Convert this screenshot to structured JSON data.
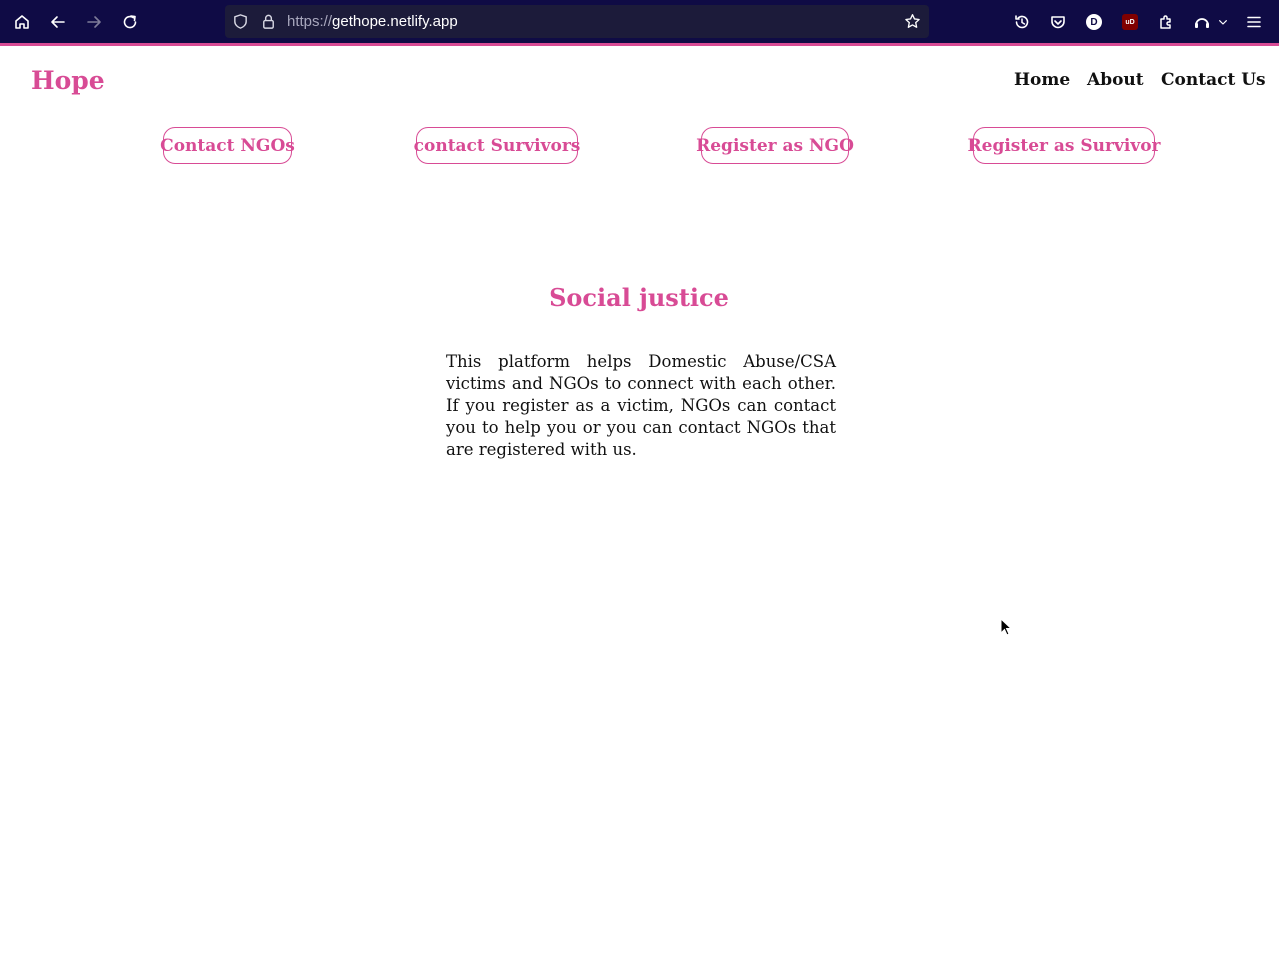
{
  "browser": {
    "url_protocol": "https://",
    "url_host": "gethope.netlify.app",
    "profile_initial": "D",
    "ublock_label": "uD",
    "toolbar_bg": "#0f0b45",
    "accent": "#d84b95",
    "icons": [
      "home-icon",
      "back-icon",
      "forward-icon",
      "reload-icon",
      "shield-icon",
      "lock-icon",
      "bookmark-star-icon",
      "history-icon",
      "pocket-icon",
      "profile-icon",
      "ublock-icon",
      "extensions-icon",
      "sync-icon",
      "chevron-down-icon",
      "menu-icon"
    ]
  },
  "site": {
    "logo": "Hope",
    "nav": [
      "Home",
      "About",
      "Contact Us"
    ],
    "actions": [
      "Contact NGOs",
      "contact Survivors",
      "Register as NGO",
      "Register as Survivor"
    ],
    "heading": "Social justice",
    "description": "This platform helps Domestic Abuse/CSA victims and NGOs to connect with each other. If you register as a victim, NGOs can contact you to help you or you can contact NGOs that are registered with us.",
    "brand_color": "#d84b95"
  }
}
